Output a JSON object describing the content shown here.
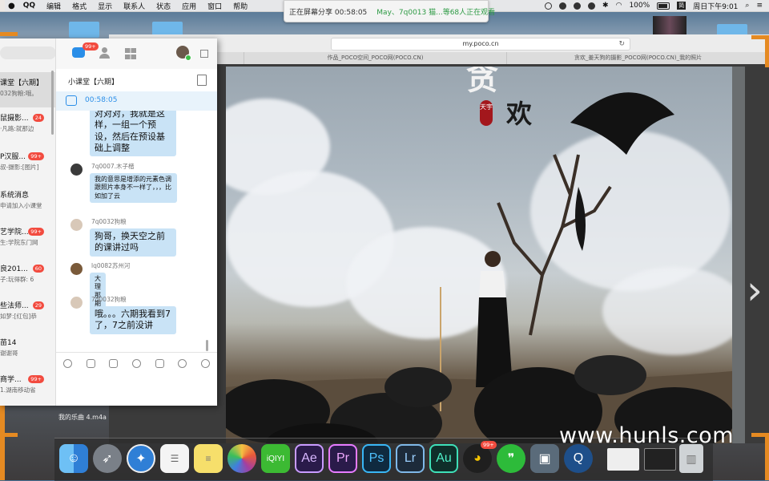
{
  "menubar": {
    "apple": "",
    "app": "QQ",
    "items": [
      "编辑",
      "格式",
      "显示",
      "联系人",
      "状态",
      "应用",
      "窗口",
      "帮助"
    ],
    "battery": "100%",
    "ime": "简",
    "clock": "周日下午9:01"
  },
  "share_banner": {
    "status": "正在屏幕分享 00:58:05",
    "viewers": "May、7q0013 猫...等68人正在观看"
  },
  "browser": {
    "url": "my.poco.cn",
    "reload": "↻",
    "tabs": [
      "POCO 中国第一图片社区",
      "作品_POCO空间_POCO网(POCO.CN)",
      "贪欢_姜天狗的摄影_POCO网(POCO.CN)_我的照片"
    ]
  },
  "photo": {
    "title_top": "贪",
    "title_main": "欢",
    "seal": "天宇"
  },
  "qq": {
    "top": {
      "badge": "99+"
    },
    "chats": [
      {
        "title": "课堂【六期】",
        "snippet": "032狗粮:哦。",
        "badge": ""
      },
      {
        "title": "鼠摄影...",
        "snippet": "·凡路:就那边",
        "badge": "24"
      },
      {
        "title": "P汉服...",
        "snippet": "叔-摄影:[图片]",
        "badge": "99+"
      },
      {
        "title": "系统消息",
        "snippet": "申请加入小课堂",
        "badge": ""
      },
      {
        "title": "艺学院...",
        "snippet": "生:学院东门网",
        "badge": "99+"
      },
      {
        "title": "良201...",
        "snippet": "子:玩得群: 6",
        "badge": "60"
      },
      {
        "title": "些法师...",
        "snippet": "如梦:[红包]恭",
        "badge": "29"
      },
      {
        "title": "苗14",
        "snippet": "谢谢哥",
        "badge": ""
      },
      {
        "title": "商学...",
        "snippet": "1.湖南移动省",
        "badge": "99+"
      }
    ],
    "header": {
      "title": "小课堂【六期】"
    },
    "share_time": "00:58:05",
    "messages": [
      {
        "name": "",
        "text": "对对对，我就是这样，一组一个预设，然后在预设基础上调整",
        "size": "big"
      },
      {
        "name": "7q0007.木子楷",
        "text": "我的意思是增添的元素色调跟照片本身不一样了，，，比如加了云",
        "size": "small"
      },
      {
        "name": "7q0032狗粮",
        "text": "狗哥，换天空之前的课讲过吗",
        "size": "big"
      },
      {
        "name": "lq0082苏州河",
        "text": "大理那期",
        "size": "small"
      },
      {
        "name": "7q0032狗粮",
        "text": "哦。。。六期我看到7了，7之前没讲",
        "size": "big"
      }
    ]
  },
  "desktop": {
    "song": "我的乐曲 4.m4a",
    "watermark": "www.hunls.com"
  },
  "dock": {
    "icons": [
      {
        "name": "finder-icon",
        "label": "",
        "color": "#3f8fe0"
      },
      {
        "name": "launchpad-icon",
        "label": "",
        "color": "#8a8f96"
      },
      {
        "name": "safari-icon",
        "label": "",
        "color": "#2f7fd6"
      },
      {
        "name": "reminders-icon",
        "label": "",
        "color": "#f4f4f4"
      },
      {
        "name": "notes-icon",
        "label": "",
        "color": "#f6df6b"
      },
      {
        "name": "photos-icon",
        "label": "",
        "color": "#ffffff"
      },
      {
        "name": "iqiyi-icon",
        "label": "iQIYI",
        "color": "#3cba33"
      },
      {
        "name": "after-effects-icon",
        "label": "Ae",
        "color": "#2a1b4a"
      },
      {
        "name": "premiere-icon",
        "label": "Pr",
        "color": "#2a1b4a"
      },
      {
        "name": "photoshop-icon",
        "label": "Ps",
        "color": "#0f2a3f"
      },
      {
        "name": "lightroom-icon",
        "label": "Lr",
        "color": "#1d2b3a"
      },
      {
        "name": "audition-icon",
        "label": "Au",
        "color": "#0f2f2a"
      },
      {
        "name": "qq-icon",
        "label": "",
        "color": "#1f1f1f"
      },
      {
        "name": "wechat-icon",
        "label": "",
        "color": "#2dbb3a"
      },
      {
        "name": "preview-icon",
        "label": "",
        "color": "#5a6b7a"
      },
      {
        "name": "quicktime-icon",
        "label": "",
        "color": "#1e4f8a"
      },
      {
        "name": "document-thumb-icon",
        "label": "",
        "color": "#eeeeee"
      },
      {
        "name": "screenshot-thumb-icon",
        "label": "",
        "color": "#222222"
      },
      {
        "name": "trash-icon",
        "label": "",
        "color": "#cfd3d6"
      }
    ],
    "qq_badge": "99+"
  }
}
